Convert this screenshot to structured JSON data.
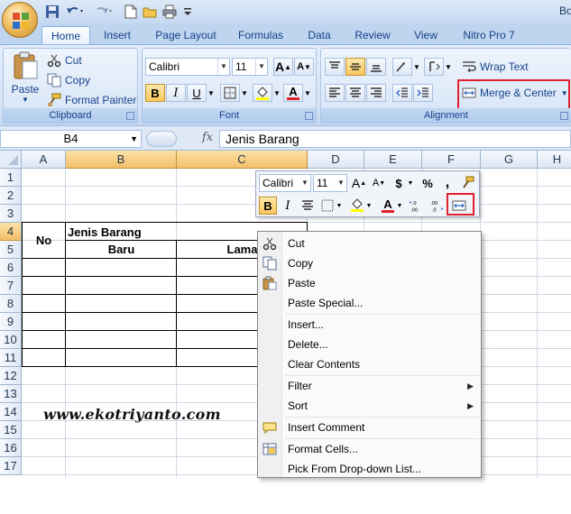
{
  "window": {
    "title": "Bo"
  },
  "tabs": [
    "Home",
    "Insert",
    "Page Layout",
    "Formulas",
    "Data",
    "Review",
    "View",
    "Nitro Pro 7"
  ],
  "ribbon": {
    "clipboard": {
      "label": "Clipboard",
      "paste": "Paste",
      "cut": "Cut",
      "copy": "Copy",
      "format_painter": "Format Painter"
    },
    "font": {
      "label": "Font",
      "font_name": "Calibri",
      "font_size": "11",
      "bold": "B",
      "italic": "I",
      "underline": "U",
      "font_color_glyph": "A",
      "grow": "A",
      "shrink": "A"
    },
    "alignment": {
      "label": "Alignment",
      "wrap_text": "Wrap Text",
      "merge_center": "Merge & Center"
    }
  },
  "formula_bar": {
    "name_box": "B4",
    "fx": "fx",
    "formula": "Jenis Barang"
  },
  "columns": [
    "A",
    "B",
    "C",
    "D",
    "E",
    "F",
    "G",
    "H"
  ],
  "rows": [
    "1",
    "2",
    "3",
    "4",
    "5",
    "6",
    "7",
    "8",
    "9",
    "10",
    "11",
    "12",
    "13",
    "14",
    "15",
    "16",
    "17"
  ],
  "cells": {
    "no": "No",
    "jenis_barang": "Jenis Barang",
    "baru": "Baru",
    "lama": "Lama"
  },
  "watermark": "www.ekotriyanto.com",
  "mini_toolbar": {
    "font_name": "Calibri",
    "font_size": "11",
    "currency": "$",
    "percent": "%",
    "comma": ",",
    "bold": "B",
    "italic": "I",
    "font_color_glyph": "A",
    "grow": "A",
    "shrink": "A"
  },
  "context_menu": {
    "cut": "Cut",
    "copy": "Copy",
    "paste": "Paste",
    "paste_special": "Paste Special...",
    "insert": "Insert...",
    "delete": "Delete...",
    "clear_contents": "Clear Contents",
    "filter": "Filter",
    "sort": "Sort",
    "insert_comment": "Insert Comment",
    "format_cells": "Format Cells...",
    "pick_from_list": "Pick From Drop-down List..."
  },
  "colors": {
    "highlight_red": "#e0202a",
    "ribbon_blue": "#15428b",
    "selection_orange": "#f4c06a"
  }
}
